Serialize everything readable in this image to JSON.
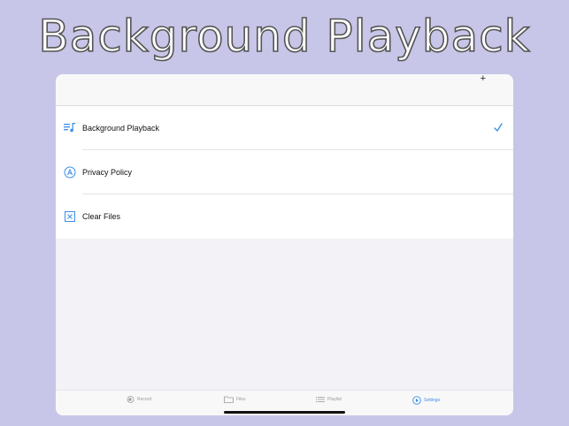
{
  "headline": "Background  Playback",
  "settings": {
    "items": [
      {
        "label": "Background Playback",
        "icon": "music-list-icon",
        "checked": true
      },
      {
        "label": "Privacy Policy",
        "icon": "app-store-icon",
        "checked": false
      },
      {
        "label": "Clear Files",
        "icon": "clear-x-icon",
        "checked": false
      }
    ]
  },
  "tabbar": {
    "tabs": [
      {
        "label": "Record",
        "icon": "camera-icon",
        "active": false
      },
      {
        "label": "Files",
        "icon": "folder-icon",
        "active": false
      },
      {
        "label": "Playlist",
        "icon": "list-icon",
        "active": false
      },
      {
        "label": "Settings",
        "icon": "play-circle-icon",
        "active": true
      }
    ]
  },
  "colors": {
    "background": "#c7c6e8",
    "accent": "#3b8ee8",
    "inactive": "#9a9aa0"
  }
}
